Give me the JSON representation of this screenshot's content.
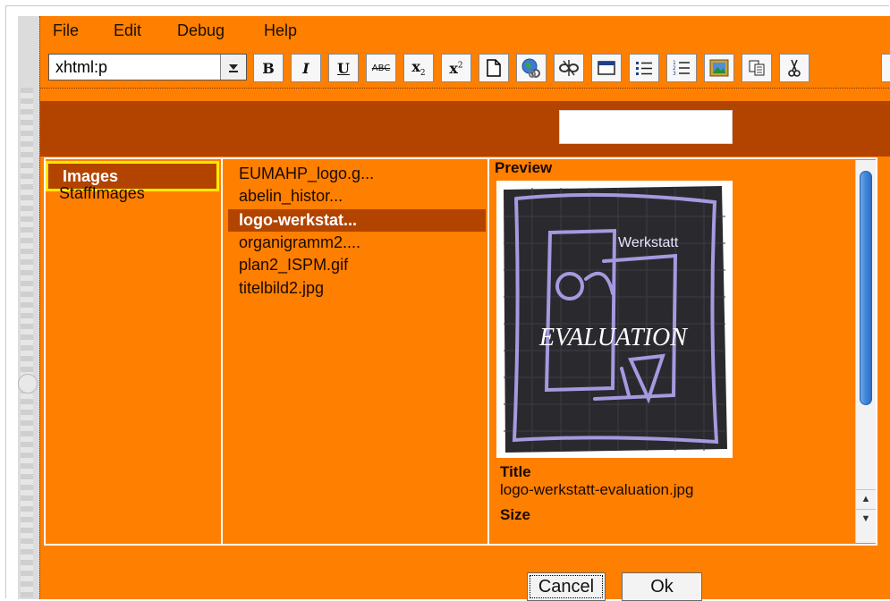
{
  "menu": [
    "File",
    "Edit",
    "Debug",
    "Help"
  ],
  "toolbar": {
    "format_select": "xhtml:p",
    "buttons": [
      "bold-icon",
      "italic-icon",
      "underline-icon",
      "strikethrough-icon",
      "subscript-icon",
      "superscript-icon",
      "new-document-icon",
      "globe-link-icon",
      "unlink-icon",
      "table-icon",
      "bullet-list-icon",
      "numbered-list-icon",
      "insert-image-icon",
      "copy-icon",
      "cut-icon"
    ],
    "bold": "B",
    "italic": "I",
    "underline": "U",
    "strike": "ABC",
    "sub": "x",
    "sub_small": "2",
    "sup": "x",
    "sup_small": "2"
  },
  "categories": [
    {
      "label": "Images",
      "selected": true
    },
    {
      "label": "StaffImages",
      "selected": false
    }
  ],
  "files": [
    {
      "label": "EUMAHP_logo.g...",
      "selected": false
    },
    {
      "label": "abelin_histor...",
      "selected": false
    },
    {
      "label": "logo-werkstat...",
      "selected": true
    },
    {
      "label": "organigramm2....",
      "selected": false
    },
    {
      "label": "plan2_ISPM.gif",
      "selected": false
    },
    {
      "label": "titelbild2.jpg",
      "selected": false
    }
  ],
  "preview": {
    "label": "Preview",
    "image_text_top": "Werkstatt",
    "image_text_main": "EVALUATION",
    "title_label": "Title",
    "title_value": "logo-werkstatt-evaluation.jpg",
    "size_label": "Size"
  },
  "buttons": {
    "cancel": "Cancel",
    "ok": "Ok"
  },
  "colors": {
    "frame": "#ff7f00",
    "header": "#b34400",
    "highlight": "#ffe800"
  }
}
